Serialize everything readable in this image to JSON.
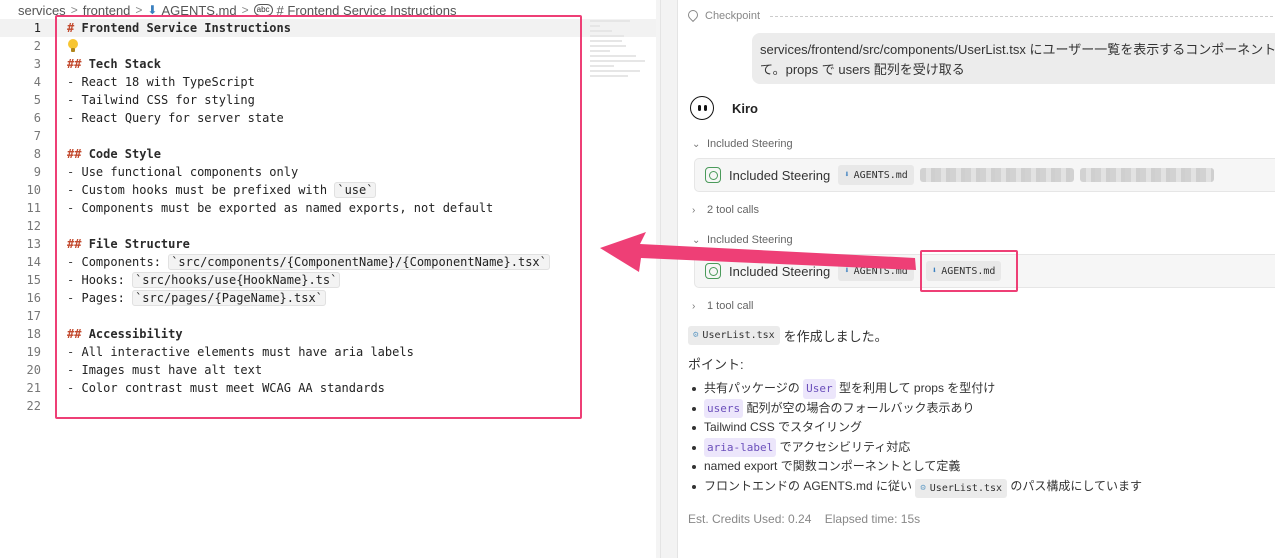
{
  "breadcrumb": {
    "items": [
      "services",
      "frontend",
      "AGENTS.md",
      "# Frontend Service Instructions"
    ],
    "separator": ">"
  },
  "editor": {
    "lines": [
      {
        "n": "1",
        "hash": "#",
        "text": "Frontend Service Instructions"
      },
      {
        "n": "2",
        "icon": "lightbulb-icon"
      },
      {
        "n": "3",
        "hash": "##",
        "text": "Tech Stack"
      },
      {
        "n": "4",
        "dash": "-",
        "text": "React 18 with TypeScript"
      },
      {
        "n": "5",
        "dash": "-",
        "text": "Tailwind CSS for styling"
      },
      {
        "n": "6",
        "dash": "-",
        "text": "React Query for server state"
      },
      {
        "n": "7"
      },
      {
        "n": "8",
        "hash": "##",
        "text": "Code Style"
      },
      {
        "n": "9",
        "dash": "-",
        "text": "Use functional components only"
      },
      {
        "n": "10",
        "dash": "-",
        "text": "Custom hooks must be prefixed with",
        "tick": "`use`"
      },
      {
        "n": "11",
        "dash": "-",
        "text": "Components must be exported as named exports, not default"
      },
      {
        "n": "12"
      },
      {
        "n": "13",
        "hash": "##",
        "text": "File Structure"
      },
      {
        "n": "14",
        "dash": "-",
        "text": "Components:",
        "tick": "`src/components/{ComponentName}/{ComponentName}.tsx`"
      },
      {
        "n": "15",
        "dash": "-",
        "text": "Hooks:",
        "tick": "`src/hooks/use{HookName}.ts`"
      },
      {
        "n": "16",
        "dash": "-",
        "text": "Pages:",
        "tick": "`src/pages/{PageName}.tsx`"
      },
      {
        "n": "17"
      },
      {
        "n": "18",
        "hash": "##",
        "text": "Accessibility"
      },
      {
        "n": "19",
        "dash": "-",
        "text": "All interactive elements must have aria labels"
      },
      {
        "n": "20",
        "dash": "-",
        "text": "Images must have alt text"
      },
      {
        "n": "21",
        "dash": "-",
        "text": "Color contrast must meet WCAG AA standards"
      },
      {
        "n": "22"
      }
    ]
  },
  "chat": {
    "checkpoint_label": "Checkpoint",
    "user_message": "services/frontend/src/components/UserList.tsx にユーザー一覧を表示するコンポーネント\nて。props で users 配列を受け取る",
    "agent_name": "Kiro",
    "steering_1": {
      "label": "Included Steering",
      "card_title": "Included Steering",
      "chip": "AGENTS.md"
    },
    "tool_calls_1": "2 tool calls",
    "steering_2": {
      "label": "Included Steering",
      "card_title": "Included Steering",
      "chips": [
        "AGENTS.md",
        "AGENTS.md"
      ]
    },
    "tool_calls_2": "1 tool call",
    "response": {
      "file_chip": "UserList.tsx",
      "created_text": "を作成しました。",
      "points_heading": "ポイント:",
      "points": [
        {
          "pre": "共有パッケージの",
          "code": "User",
          "post": "型を利用して props を型付け"
        },
        {
          "pre": "",
          "code": "users",
          "post": "配列が空の場合のフォールバック表示あり"
        },
        {
          "pre": "Tailwind CSS でスタイリング",
          "code": "",
          "post": ""
        },
        {
          "pre": "",
          "code": "aria-label",
          "post": "でアクセシビリティ対応"
        },
        {
          "pre": "named export で関数コンポーネントとして定義",
          "code": "",
          "post": ""
        },
        {
          "pre": "フロントエンドの AGENTS.md に従い",
          "chip": "UserList.tsx",
          "post": "のパス構成にしています"
        }
      ]
    },
    "footer": {
      "credits": "Est. Credits Used: 0.24",
      "elapsed": "Elapsed time: 15s"
    }
  },
  "colors": {
    "highlight": "#ee3f76",
    "heading_hash": "#c24a2e",
    "code_chip_purple": "#6b4fbb"
  }
}
